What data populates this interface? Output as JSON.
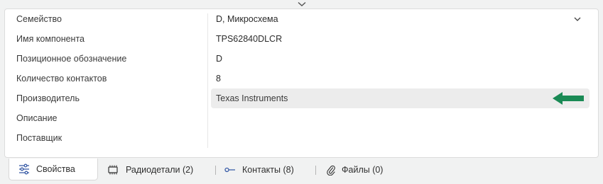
{
  "properties": {
    "rows": [
      {
        "label": "Семейство",
        "value": "D, Микросхема"
      },
      {
        "label": "Имя компонента",
        "value": "TPS62840DLCR"
      },
      {
        "label": "Позиционное обозначение",
        "value": "D"
      },
      {
        "label": "Количество контактов",
        "value": "8"
      },
      {
        "label": "Производитель",
        "value": "Texas Instruments"
      },
      {
        "label": "Описание",
        "value": ""
      },
      {
        "label": "Поставщик",
        "value": ""
      }
    ]
  },
  "tabs": [
    {
      "label": "Свойства",
      "icon": "sliders-icon",
      "active": true
    },
    {
      "label": "Радиодетали (2)",
      "icon": "chip-icon",
      "active": false
    },
    {
      "label": "Контакты (8)",
      "icon": "pin-icon",
      "active": false
    },
    {
      "label": "Файлы (0)",
      "icon": "paperclip-icon",
      "active": false
    }
  ],
  "colors": {
    "arrow": "#1a8a55",
    "highlight": "#ececec",
    "tab_icon": "#3b5ea8"
  }
}
